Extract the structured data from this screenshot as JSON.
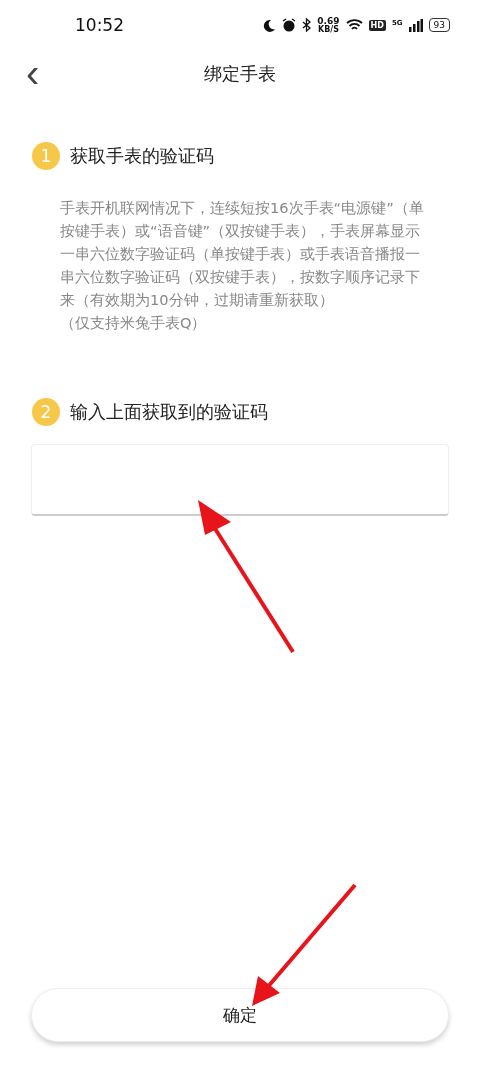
{
  "status_bar": {
    "time": "10:52",
    "speed_value": "0.69",
    "speed_unit": "KB/S",
    "hd_badge": "HD",
    "network": "5G",
    "battery": "93"
  },
  "header": {
    "back": "‹",
    "title": "绑定手表"
  },
  "steps": [
    {
      "number": "1",
      "title": "获取手表的验证码",
      "description": "手表开机联网情况下，连续短按16次手表“电源键”（单按键手表）或“语音键”（双按键手表），手表屏幕显示一串六位数字验证码（单按键手表）或手表语音播报一串六位数字验证码（双按键手表），按数字顺序记录下来（有效期为10分钟，过期请重新获取）",
      "note": "（仅支持米兔手表Q）"
    },
    {
      "number": "2",
      "title": "输入上面获取到的验证码"
    }
  ],
  "confirm_button": "确定"
}
